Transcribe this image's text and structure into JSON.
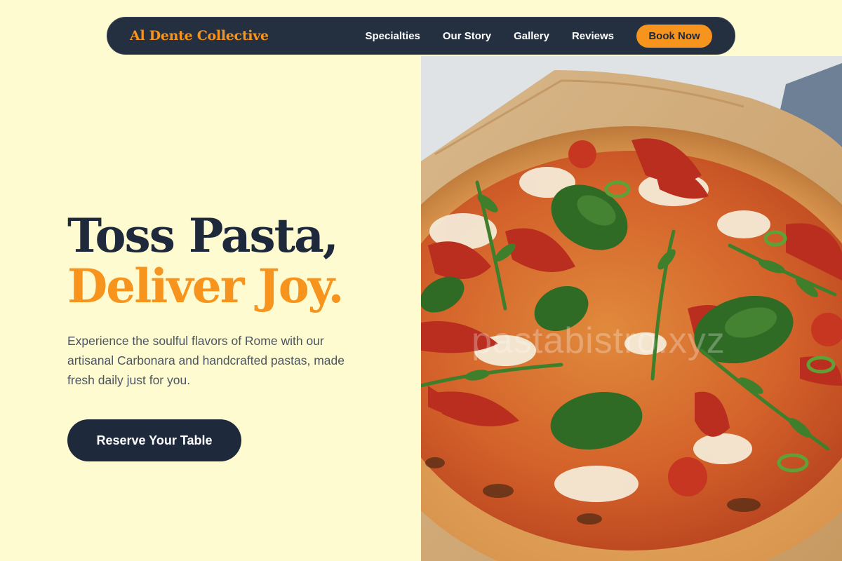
{
  "brand": {
    "name": "Al Dente Collective",
    "color": "#f7941d"
  },
  "nav": {
    "links": [
      "Specialties",
      "Our Story",
      "Gallery",
      "Reviews"
    ],
    "cta": "Book Now"
  },
  "hero": {
    "title_line1": "Toss Pasta,",
    "title_line2": "Deliver Joy.",
    "description": "Experience the soulful flavors of Rome with our artisanal Carbonara and handcrafted pastas, made fresh daily just for you.",
    "button": "Reserve Your Table"
  },
  "image": {
    "subject": "pizza-photo",
    "watermark": "pastabistro.xyz"
  },
  "colors": {
    "background": "#fffbd1",
    "navy": "#1e293b",
    "accent": "#f7941d"
  }
}
